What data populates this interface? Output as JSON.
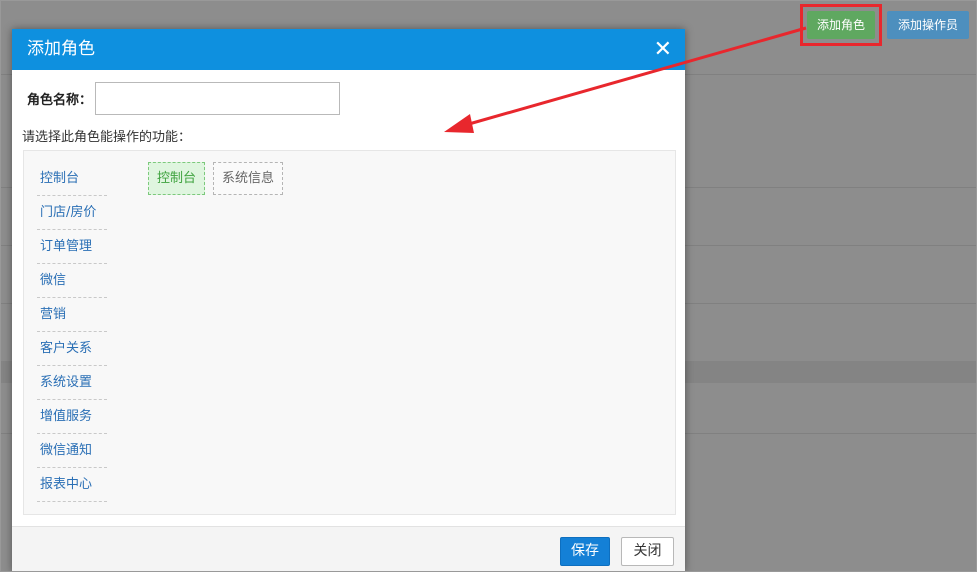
{
  "toolbar": {
    "add_role_label": "添加角色",
    "add_operator_label": "添加操作员"
  },
  "modal": {
    "title": "添加角色",
    "close_glyph": "✕",
    "role_name_label": "角色名称：",
    "role_name_value": "",
    "select_prompt": "请选择此角色能操作的功能：",
    "functions": [
      {
        "label": "控制台"
      },
      {
        "label": "门店/房价"
      },
      {
        "label": "订单管理"
      },
      {
        "label": "微信"
      },
      {
        "label": "营销"
      },
      {
        "label": "客户关系"
      },
      {
        "label": "系统设置"
      },
      {
        "label": "增值服务"
      },
      {
        "label": "微信通知"
      },
      {
        "label": "报表中心"
      }
    ],
    "sub_functions": [
      {
        "label": "控制台",
        "selected": true
      },
      {
        "label": "系统信息",
        "selected": false
      }
    ],
    "save_label": "保存",
    "close_label": "关闭"
  },
  "colors": {
    "header": "#0e90df",
    "highlight": "#e8272d",
    "save": "#1480d6",
    "add_role_button": "#5fa860",
    "add_operator_button": "#4d8fbe"
  }
}
